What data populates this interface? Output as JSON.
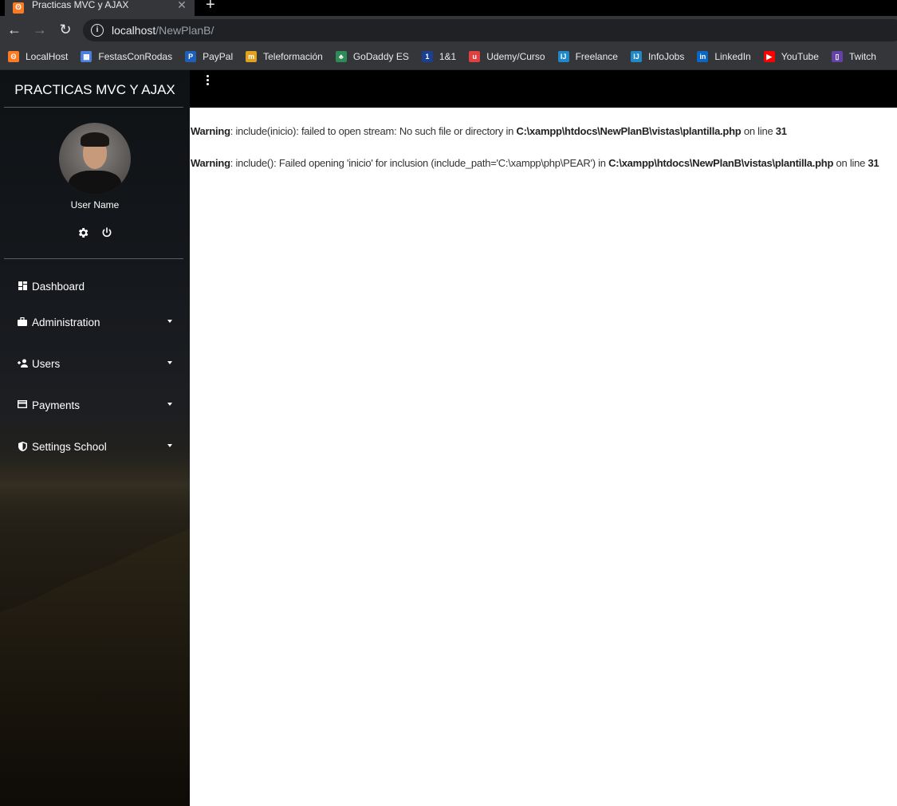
{
  "browser": {
    "tab": {
      "title": "Practicas MVC y AJAX",
      "favicon": "xampp-icon"
    },
    "new_tab_label": "+",
    "address": {
      "host": "localhost",
      "path": "/NewPlanB/"
    },
    "bookmarks": [
      {
        "label": "LocalHost",
        "icon": "xampp-icon",
        "color": "#fb7a24"
      },
      {
        "label": "FestasConRodas",
        "icon": "store-icon",
        "color": "#4a7fe0"
      },
      {
        "label": "PayPal",
        "icon": "paypal-icon",
        "color": "#1e5fb8"
      },
      {
        "label": "Teleformación",
        "icon": "tf-icon",
        "color": "#e0a020"
      },
      {
        "label": "GoDaddy ES",
        "icon": "godaddy-icon",
        "color": "#2e8b57"
      },
      {
        "label": "1&1",
        "icon": "oneandone-icon",
        "color": "#1c3f94"
      },
      {
        "label": "Udemy/Curso",
        "icon": "udemy-icon",
        "color": "#e04040"
      },
      {
        "label": "Freelance",
        "icon": "ij-icon",
        "color": "#1e88c8"
      },
      {
        "label": "InfoJobs",
        "icon": "ij-icon",
        "color": "#1e88c8"
      },
      {
        "label": "LinkedIn",
        "icon": "linkedin-icon",
        "color": "#0a66c2"
      },
      {
        "label": "YouTube",
        "icon": "youtube-icon",
        "color": "#ff0000"
      },
      {
        "label": "Twitch",
        "icon": "twitch-icon",
        "color": "#6441a5"
      }
    ]
  },
  "sidebar": {
    "brand": "PRACTICAS MVC Y AJAX",
    "user_name": "User Name",
    "menu": [
      {
        "label": "Dashboard",
        "icon": "dashboard-icon",
        "has_submenu": false
      },
      {
        "label": "Administration",
        "icon": "briefcase-icon",
        "has_submenu": true
      },
      {
        "label": "Users",
        "icon": "add-user-icon",
        "has_submenu": true
      },
      {
        "label": "Payments",
        "icon": "credit-card-icon",
        "has_submenu": true
      },
      {
        "label": "Settings School",
        "icon": "shield-icon",
        "has_submenu": true
      }
    ]
  },
  "main": {
    "warnings": [
      {
        "label": "Warning",
        "message": ": include(inicio): failed to open stream: No such file or directory in ",
        "file": "C:\\xampp\\htdocs\\NewPlanB\\vistas\\plantilla.php",
        "line_text": " on line ",
        "line": "31"
      },
      {
        "label": "Warning",
        "message": ": include(): Failed opening 'inicio' for inclusion (include_path='C:\\xampp\\php\\PEAR') in ",
        "file": "C:\\xampp\\htdocs\\NewPlanB\\vistas\\plantilla.php",
        "line_text": " on line ",
        "line": "31"
      }
    ]
  }
}
